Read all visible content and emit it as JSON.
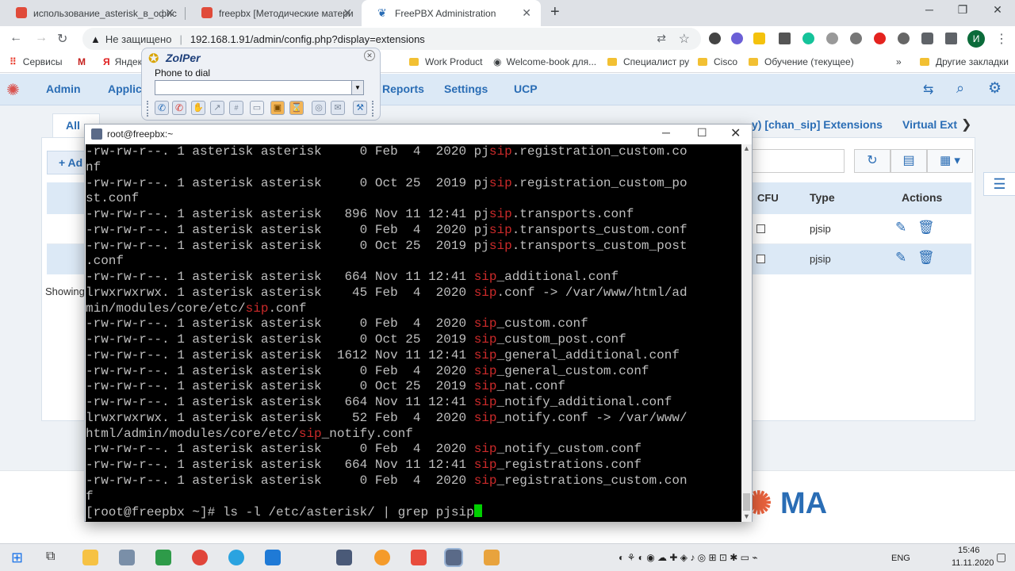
{
  "browser": {
    "tabs": [
      {
        "title": "использование_asterisk_в_офис",
        "active": false
      },
      {
        "title": "freepbx [Методические матери",
        "active": false
      },
      {
        "title": "FreePBX Administration",
        "active": true
      }
    ],
    "new_tab": "+",
    "security_label": "Не защищено",
    "url": "192.168.1.91/admin/config.php?display=extensions",
    "bookmarks": [
      {
        "label": "Сервисы"
      },
      {
        "label": "Яндекс"
      },
      {
        "label": "Work Product"
      },
      {
        "label": "Welcome-book для..."
      },
      {
        "label": "Специалист ру"
      },
      {
        "label": "Cisco"
      },
      {
        "label": "Обучение (текущее)"
      },
      {
        "label": "Другие закладки"
      }
    ],
    "profile_initial": "И",
    "colors": {
      "tabstrip": "#dee1e6",
      "accent": "#1a73e8"
    }
  },
  "freepbx": {
    "nav": [
      "Admin",
      "Applic",
      "Reports",
      "Settings",
      "UCP"
    ],
    "tabs": {
      "all": "All",
      "chan_sip": "y) [chan_sip] Extensions",
      "virtual": "Virtual Ext"
    },
    "add_label": "+ Ad",
    "columns": {
      "cfu": "CFU",
      "type": "Type",
      "actions": "Actions"
    },
    "rows": [
      {
        "type": "pjsip"
      },
      {
        "type": "pjsip"
      }
    ],
    "showing": "Showing",
    "logo_text": "MA",
    "colors": {
      "nav": "#dce9f6",
      "link": "#2a6db5",
      "logo": "#e8613c"
    }
  },
  "zoiper": {
    "title": "ZoIPer",
    "phone_label": "Phone to dial",
    "phone_value": ""
  },
  "putty": {
    "title": "root@freepbx:~",
    "lines": [
      [
        {
          "t": "-rw-rw-r--. 1 asterisk asterisk     0 Feb  4  2020 pj"
        },
        {
          "t": "sip",
          "r": true
        },
        {
          "t": ".registration_custom.co"
        }
      ],
      [
        {
          "t": "nf"
        }
      ],
      [
        {
          "t": "-rw-rw-r--. 1 asterisk asterisk     0 Oct 25  2019 pj"
        },
        {
          "t": "sip",
          "r": true
        },
        {
          "t": ".registration_custom_po"
        }
      ],
      [
        {
          "t": "st.conf"
        }
      ],
      [
        {
          "t": "-rw-rw-r--. 1 asterisk asterisk   896 Nov 11 12:41 pj"
        },
        {
          "t": "sip",
          "r": true
        },
        {
          "t": ".transports.conf"
        }
      ],
      [
        {
          "t": "-rw-rw-r--. 1 asterisk asterisk     0 Feb  4  2020 pj"
        },
        {
          "t": "sip",
          "r": true
        },
        {
          "t": ".transports_custom.conf"
        }
      ],
      [
        {
          "t": "-rw-rw-r--. 1 asterisk asterisk     0 Oct 25  2019 pj"
        },
        {
          "t": "sip",
          "r": true
        },
        {
          "t": ".transports_custom_post"
        }
      ],
      [
        {
          "t": ".conf"
        }
      ],
      [
        {
          "t": "-rw-rw-r--. 1 asterisk asterisk   664 Nov 11 12:41 "
        },
        {
          "t": "sip",
          "r": true
        },
        {
          "t": "_additional.conf"
        }
      ],
      [
        {
          "t": "lrwxrwxrwx. 1 asterisk asterisk    45 Feb  4  2020 "
        },
        {
          "t": "sip",
          "r": true
        },
        {
          "t": ".conf -> /var/www/html/ad"
        }
      ],
      [
        {
          "t": "min/modules/core/etc/"
        },
        {
          "t": "sip",
          "r": true
        },
        {
          "t": ".conf"
        }
      ],
      [
        {
          "t": "-rw-rw-r--. 1 asterisk asterisk     0 Feb  4  2020 "
        },
        {
          "t": "sip",
          "r": true
        },
        {
          "t": "_custom.conf"
        }
      ],
      [
        {
          "t": "-rw-rw-r--. 1 asterisk asterisk     0 Oct 25  2019 "
        },
        {
          "t": "sip",
          "r": true
        },
        {
          "t": "_custom_post.conf"
        }
      ],
      [
        {
          "t": "-rw-rw-r--. 1 asterisk asterisk  1612 Nov 11 12:41 "
        },
        {
          "t": "sip",
          "r": true
        },
        {
          "t": "_general_additional.conf"
        }
      ],
      [
        {
          "t": "-rw-rw-r--. 1 asterisk asterisk     0 Feb  4  2020 "
        },
        {
          "t": "sip",
          "r": true
        },
        {
          "t": "_general_custom.conf"
        }
      ],
      [
        {
          "t": "-rw-rw-r--. 1 asterisk asterisk     0 Oct 25  2019 "
        },
        {
          "t": "sip",
          "r": true
        },
        {
          "t": "_nat.conf"
        }
      ],
      [
        {
          "t": "-rw-rw-r--. 1 asterisk asterisk   664 Nov 11 12:41 "
        },
        {
          "t": "sip",
          "r": true
        },
        {
          "t": "_notify_additional.conf"
        }
      ],
      [
        {
          "t": "lrwxrwxrwx. 1 asterisk asterisk    52 Feb  4  2020 "
        },
        {
          "t": "sip",
          "r": true
        },
        {
          "t": "_notify.conf -> /var/www/"
        }
      ],
      [
        {
          "t": "html/admin/modules/core/etc/"
        },
        {
          "t": "sip",
          "r": true
        },
        {
          "t": "_notify.conf"
        }
      ],
      [
        {
          "t": "-rw-rw-r--. 1 asterisk asterisk     0 Feb  4  2020 "
        },
        {
          "t": "sip",
          "r": true
        },
        {
          "t": "_notify_custom.conf"
        }
      ],
      [
        {
          "t": "-rw-rw-r--. 1 asterisk asterisk   664 Nov 11 12:41 "
        },
        {
          "t": "sip",
          "r": true
        },
        {
          "t": "_registrations.conf"
        }
      ],
      [
        {
          "t": "-rw-rw-r--. 1 asterisk asterisk     0 Feb  4  2020 "
        },
        {
          "t": "sip",
          "r": true
        },
        {
          "t": "_registrations_custom.con"
        }
      ],
      [
        {
          "t": "f"
        }
      ]
    ],
    "prompt": "[root@freepbx ~]# ls -l /etc/asterisk/ | grep pjsip"
  },
  "taskbar": {
    "language": "ENG",
    "time": "15:46",
    "date": "11.11.2020"
  }
}
